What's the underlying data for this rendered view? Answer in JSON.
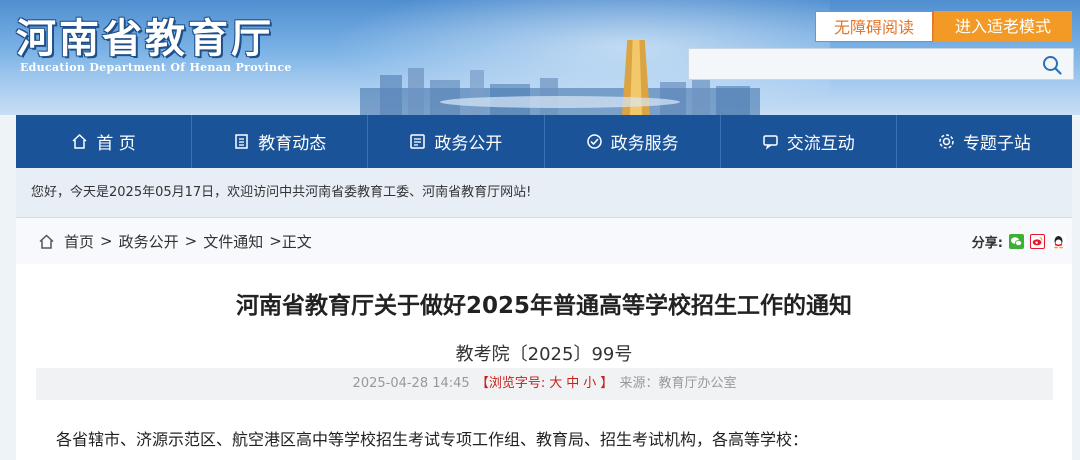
{
  "header": {
    "logo_cn": "河南省教育厅",
    "logo_en": "Education Department Of Henan Province",
    "accessible_read": "无障碍阅读",
    "elder_mode": "进入适老模式",
    "search_placeholder": ""
  },
  "nav": {
    "items": [
      {
        "label": "首 页",
        "icon": "home-icon"
      },
      {
        "label": "教育动态",
        "icon": "news-icon"
      },
      {
        "label": "政务公开",
        "icon": "document-icon"
      },
      {
        "label": "政务服务",
        "icon": "service-icon"
      },
      {
        "label": "交流互动",
        "icon": "chat-icon"
      },
      {
        "label": "专题子站",
        "icon": "topic-icon"
      }
    ]
  },
  "welcome": "您好，今天是2025年05月17日，欢迎访问中共河南省委教育工委、河南省教育厅网站!",
  "breadcrumb": {
    "items": [
      "首页",
      "政务公开",
      "文件通知",
      "正文"
    ],
    "separator": ">"
  },
  "share": {
    "label": "分享:",
    "icons": [
      "wechat-icon",
      "weibo-icon",
      "qq-icon"
    ]
  },
  "article": {
    "title": "河南省教育厅关于做好2025年普通高等学校招生工作的通知",
    "doc_number": "教考院〔2025〕99号",
    "date": "2025-04-28 14:45",
    "font_size_label": "【浏览字号:",
    "font_sizes": [
      "大",
      "中",
      "小"
    ],
    "font_size_close": "】",
    "source": "来源：教育厅办公室",
    "first_line": "各省辖市、济源示范区、航空港区高中等学校招生考试专项工作组、教育局、招生考试机构，各高等学校："
  },
  "colors": {
    "nav_bg": "#1b5399",
    "accent_orange": "#f39a26",
    "font_size_red": "#c8201a"
  }
}
